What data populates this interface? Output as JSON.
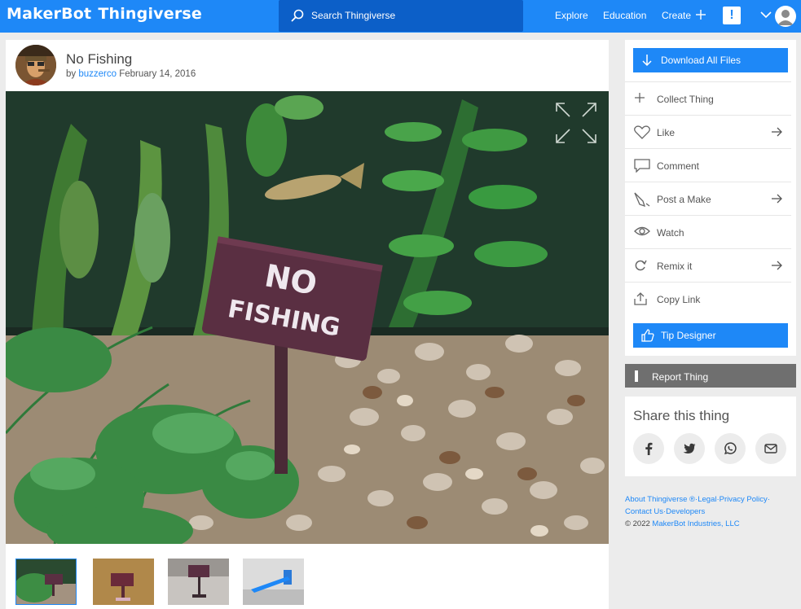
{
  "header": {
    "logo_primary": "MakerBot",
    "logo_secondary": "Thingiverse",
    "search_placeholder": "Search Thingiverse",
    "nav": {
      "explore": "Explore",
      "education": "Education",
      "create": "Create"
    },
    "alert_label": "!",
    "colors": {
      "bar": "#1e88f7",
      "search_bg": "#0c5fc8"
    }
  },
  "thing": {
    "title": "No Fishing",
    "by_prefix": "by",
    "author": "buzzerco",
    "date": "February 14, 2016",
    "hero_sign_line1": "NO",
    "hero_sign_line2": "FISHING",
    "thumbnail_count": 4,
    "active_thumbnail": 1
  },
  "actions": {
    "download_all": "Download All Files",
    "collect": "Collect Thing",
    "like": "Like",
    "comment": "Comment",
    "post_make": "Post a Make",
    "watch": "Watch",
    "remix": "Remix it",
    "copy_link": "Copy Link",
    "tip_designer": "Tip Designer",
    "report": "Report Thing"
  },
  "share": {
    "title": "Share this thing",
    "networks": [
      "facebook-icon",
      "twitter-icon",
      "whatsapp-icon",
      "email-icon"
    ]
  },
  "footer": {
    "about": "About Thingiverse ®",
    "sep1": "·",
    "legal": "Legal",
    "sep2": "·",
    "privacy": "Privacy Policy",
    "sep3": "·",
    "contact": "Contact Us",
    "sep4": "·",
    "developers": "Developers",
    "copyright_prefix": "© 2022",
    "company": "MakerBot Industries, LLC"
  }
}
